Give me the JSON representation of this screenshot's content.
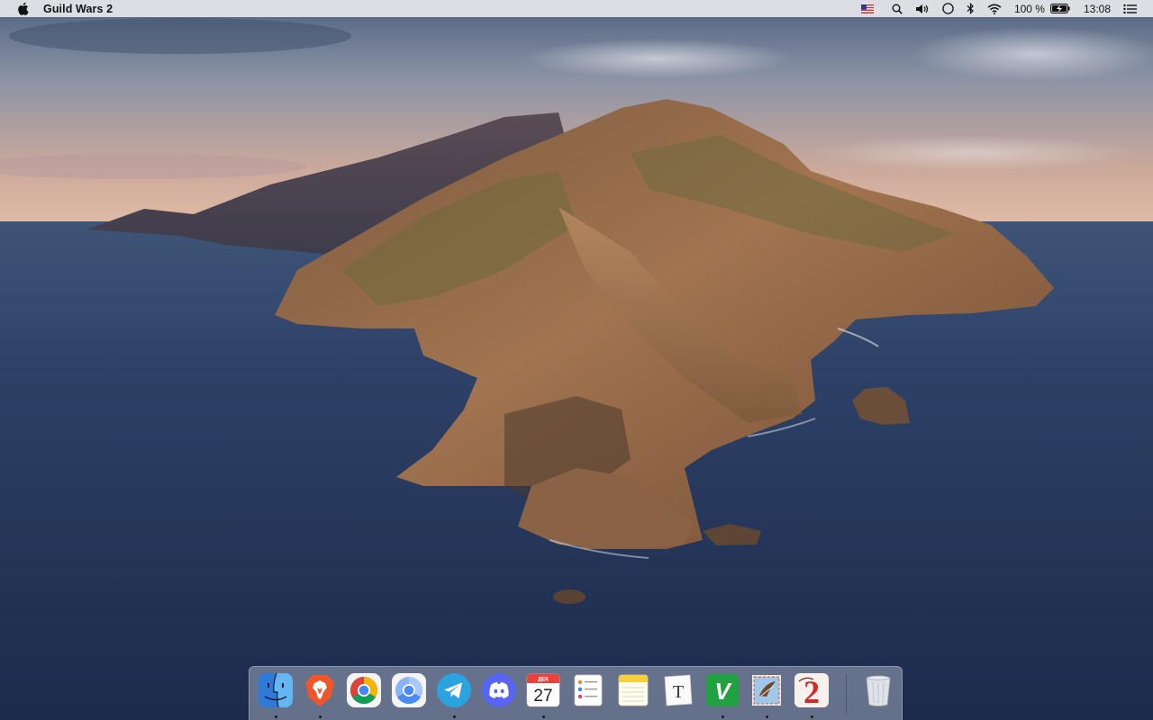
{
  "menubar": {
    "app_name": "Guild Wars 2",
    "battery_percent": "100 %",
    "clock": "13:08",
    "status_icons": [
      "flag-us-icon",
      "search-icon",
      "volume-icon",
      "siri-icon",
      "bluetooth-icon",
      "wifi-icon",
      "battery-charging-icon",
      "notification-center-icon"
    ]
  },
  "wallpaper": {
    "description_colors": {
      "sky_top": "#5d6f8a",
      "sky_horizon": "#d9b3a0",
      "sea": "#2b3d60",
      "island": "#9c6a45"
    }
  },
  "dock": {
    "items": [
      {
        "name": "finder",
        "icon": "finder-icon",
        "running": true
      },
      {
        "name": "brave",
        "icon": "brave-icon",
        "running": true
      },
      {
        "name": "chrome",
        "icon": "chrome-icon",
        "running": false
      },
      {
        "name": "chromium",
        "icon": "chromium-icon",
        "running": false
      },
      {
        "name": "telegram",
        "icon": "telegram-icon",
        "running": true
      },
      {
        "name": "discord",
        "icon": "discord-icon",
        "running": false
      },
      {
        "name": "calendar",
        "icon": "calendar-icon",
        "running": true,
        "month": "ДЕК",
        "day": "27"
      },
      {
        "name": "reminders",
        "icon": "reminders-icon",
        "running": false
      },
      {
        "name": "notes",
        "icon": "notes-icon",
        "running": false
      },
      {
        "name": "typora",
        "icon": "typora-icon",
        "running": false,
        "glyph": "T"
      },
      {
        "name": "vim",
        "icon": "vim-icon",
        "running": true,
        "glyph": "V"
      },
      {
        "name": "mail",
        "icon": "mail-icon",
        "running": true
      },
      {
        "name": "guild-wars-2",
        "icon": "guild-wars-2-icon",
        "running": true,
        "glyph": "2"
      },
      {
        "name": "trash",
        "icon": "trash-icon",
        "running": false
      }
    ]
  }
}
